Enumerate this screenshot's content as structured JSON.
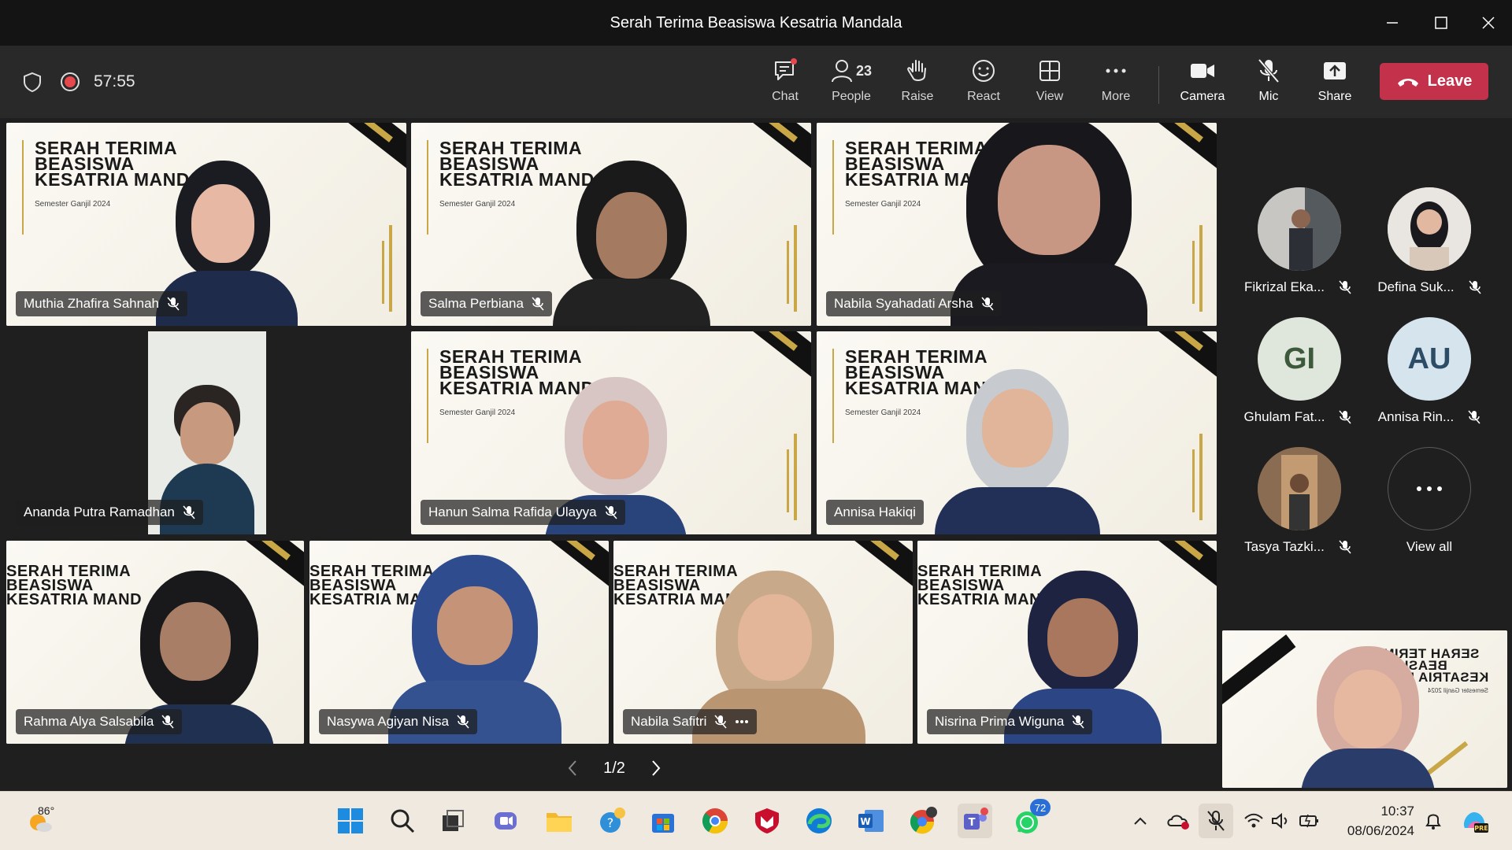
{
  "window": {
    "title": "Serah Terima Beasiswa Kesatria Mandala"
  },
  "toolbar": {
    "timer": "57:55",
    "chat": "Chat",
    "people": "People",
    "people_count": "23",
    "raise": "Raise",
    "react": "React",
    "view": "View",
    "more": "More",
    "camera": "Camera",
    "mic": "Mic",
    "share": "Share",
    "leave": "Leave"
  },
  "banner": {
    "line1": "SERAH TERIMA",
    "line2": "BEASISWA",
    "line3": "KESATRIA MAND",
    "sub": "Semester Ganjil 2024"
  },
  "tiles": [
    {
      "name": "Muthia Zhafira Sahnah"
    },
    {
      "name": "Salma Perbiana"
    },
    {
      "name": "Nabila Syahadati Arsha"
    },
    {
      "name": "Ananda Putra Ramadhan"
    },
    {
      "name": "Hanun Salma Rafida Ulayya"
    },
    {
      "name": "Annisa Hakiqi"
    },
    {
      "name": "Rahma Alya Salsabila"
    },
    {
      "name": "Nasywa Agiyan Nisa"
    },
    {
      "name": "Nabila Safitri"
    },
    {
      "name": "Nisrina Prima Wiguna"
    }
  ],
  "roster": [
    {
      "name": "Fikrizal Eka...",
      "initials": ""
    },
    {
      "name": "Defina Suk...",
      "initials": ""
    },
    {
      "name": "Ghulam Fat...",
      "initials": "GI"
    },
    {
      "name": "Annisa Rin...",
      "initials": "AU"
    },
    {
      "name": "Tasya Tazki...",
      "initials": ""
    },
    {
      "name": "View all",
      "initials": ""
    }
  ],
  "self_banner": {
    "line1": "SERAH TERIMA",
    "line2": "BEASISWA",
    "line3": "KESATRIA MAND",
    "sub": "Semester Ganjil 2024"
  },
  "pager": {
    "label": "1/2"
  },
  "taskbar": {
    "weather": "86°",
    "whatsapp_badge": "72",
    "time": "10:37",
    "date": "08/06/2024"
  },
  "colors": {
    "leave": "#c4314b",
    "record": "#e5484d",
    "accent": "#6264a7"
  }
}
